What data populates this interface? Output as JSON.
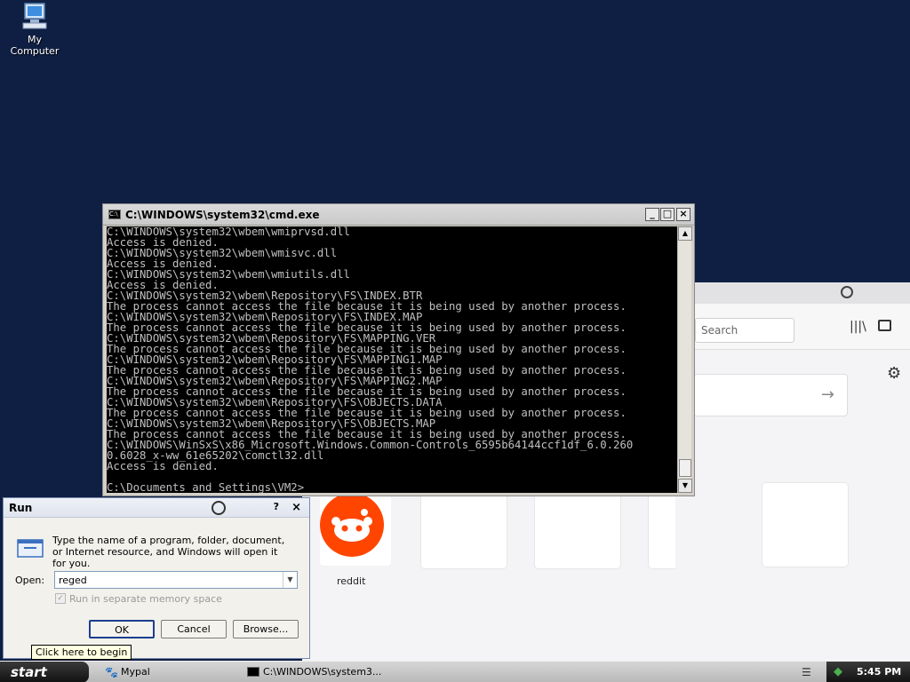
{
  "desktop": {
    "icon_label": "My Computer"
  },
  "browser": {
    "search_placeholder": "Search",
    "tile_label": "reddit"
  },
  "cmd": {
    "title": "C:\\WINDOWS\\system32\\cmd.exe",
    "lines": [
      "C:\\WINDOWS\\system32\\wbem\\wmiprvsd.dll",
      "Access is denied.",
      "C:\\WINDOWS\\system32\\wbem\\wmisvc.dll",
      "Access is denied.",
      "C:\\WINDOWS\\system32\\wbem\\wmiutils.dll",
      "Access is denied.",
      "C:\\WINDOWS\\system32\\wbem\\Repository\\FS\\INDEX.BTR",
      "The process cannot access the file because it is being used by another process.",
      "C:\\WINDOWS\\system32\\wbem\\Repository\\FS\\INDEX.MAP",
      "The process cannot access the file because it is being used by another process.",
      "C:\\WINDOWS\\system32\\wbem\\Repository\\FS\\MAPPING.VER",
      "The process cannot access the file because it is being used by another process.",
      "C:\\WINDOWS\\system32\\wbem\\Repository\\FS\\MAPPING1.MAP",
      "The process cannot access the file because it is being used by another process.",
      "C:\\WINDOWS\\system32\\wbem\\Repository\\FS\\MAPPING2.MAP",
      "The process cannot access the file because it is being used by another process.",
      "C:\\WINDOWS\\system32\\wbem\\Repository\\FS\\OBJECTS.DATA",
      "The process cannot access the file because it is being used by another process.",
      "C:\\WINDOWS\\system32\\wbem\\Repository\\FS\\OBJECTS.MAP",
      "The process cannot access the file because it is being used by another process.",
      "C:\\WINDOWS\\WinSxS\\x86_Microsoft.Windows.Common-Controls_6595b64144ccf1df_6.0.260",
      "0.6028_x-ww_61e65202\\comctl32.dll",
      "Access is denied.",
      "",
      "C:\\Documents and Settings\\VM2>"
    ]
  },
  "run": {
    "title": "Run",
    "help": "?",
    "close": "×",
    "description": "Type the name of a program, folder, document, or Internet resource, and Windows will open it for you.",
    "open_label": "Open:",
    "open_value": "reged",
    "checkbox_label": "Run in separate memory space",
    "ok": "OK",
    "cancel": "Cancel",
    "browse": "Browse..."
  },
  "tooltip": "Click here to begin",
  "taskbar": {
    "start": "start",
    "tasks": [
      "Mypal",
      "C:\\WINDOWS\\system3..."
    ],
    "time": "5:45 PM"
  }
}
